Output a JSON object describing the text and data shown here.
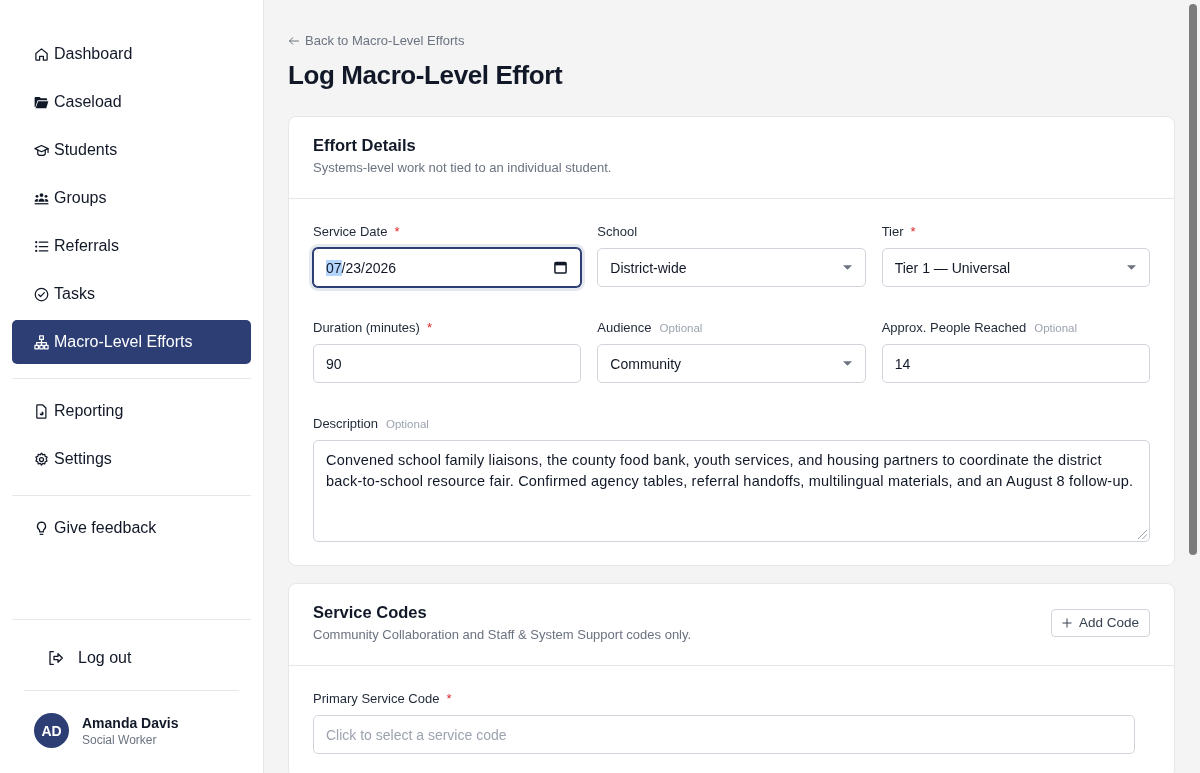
{
  "sidebar": {
    "sections": [
      {
        "items": [
          {
            "label": "Dashboard",
            "selected": false
          },
          {
            "label": "Caseload",
            "selected": false
          },
          {
            "label": "Students",
            "selected": false
          },
          {
            "label": "Groups",
            "selected": false
          },
          {
            "label": "Referrals",
            "selected": false
          },
          {
            "label": "Tasks",
            "selected": false
          },
          {
            "label": "Macro-Level Efforts",
            "selected": true
          }
        ]
      },
      {
        "items": [
          {
            "label": "Reporting",
            "selected": false
          },
          {
            "label": "Settings",
            "selected": false
          }
        ]
      },
      {
        "items": [
          {
            "label": "Give feedback",
            "selected": false
          }
        ]
      }
    ],
    "logout": {
      "label": "Log out"
    },
    "user": {
      "initials": "AD",
      "name": "Amanda Davis",
      "role": "Social Worker"
    }
  },
  "page": {
    "back_link": "Back to Macro-Level Efforts",
    "title": "Log Macro-Level Effort"
  },
  "effort_details": {
    "title": "Effort Details",
    "subtitle": "Systems-level work not tied to an individual student.",
    "fields": [
      {
        "label": "Service Date",
        "required_mark": "*",
        "kind": "date",
        "value": "07/23/2026",
        "focused": true
      },
      {
        "label": "School",
        "kind": "select",
        "value": "District-wide",
        "focused": false
      },
      {
        "label": "Tier",
        "required_mark": "*",
        "kind": "select",
        "value": "Tier 1 — Universal",
        "focused": false
      },
      {
        "label": "Duration (minutes)",
        "required_mark": "*",
        "kind": "text",
        "value": "90",
        "focused": false
      },
      {
        "label": "Audience",
        "optional_note": "Optional",
        "kind": "select",
        "value": "Community",
        "focused": false
      },
      {
        "label": "Approx. People Reached",
        "optional_note": "Optional",
        "kind": "text",
        "value": "14",
        "focused": false
      },
      {
        "label": "Description",
        "optional_note": "Optional",
        "kind": "textarea",
        "value": "Convened school family liaisons, the county food bank, youth services, and housing partners to coordinate the district back-to-school resource fair. Confirmed agency tables, referral handoffs, multilingual materials, and an August 8 follow-up.",
        "focused": false
      }
    ]
  },
  "service_codes": {
    "title": "Service Codes",
    "subtitle": "Community Collaboration and Staff & System Support codes only.",
    "add_button": "Add Code",
    "fields": [
      {
        "label": "Primary Service Code",
        "required_mark": "*",
        "kind": "picker",
        "placeholder": "Click to select a service code",
        "focused": false
      }
    ]
  }
}
